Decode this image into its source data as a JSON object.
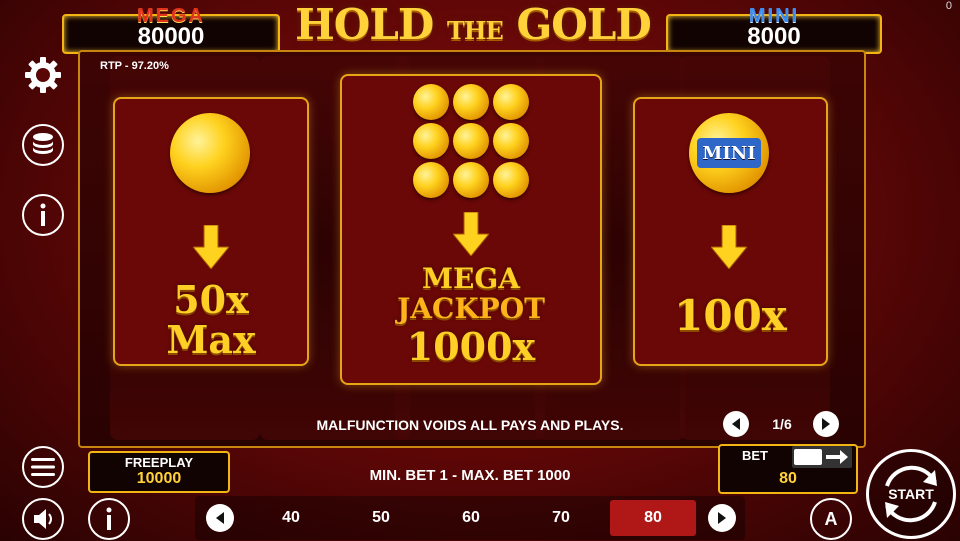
{
  "jackpots": {
    "mega": {
      "title": "MEGA",
      "value": "80000"
    },
    "mini": {
      "title": "MINI",
      "value": "8000"
    }
  },
  "logo": {
    "word1": "HOLD",
    "word2": "THE",
    "word3": "GOLD"
  },
  "corner_counter": "0",
  "rtp": "RTP - 97.20%",
  "panels": {
    "left": {
      "line1": "50x",
      "line2": "Max"
    },
    "center": {
      "line1": "MEGA",
      "line2": "JACKPOT",
      "line3": "1000x"
    },
    "right": {
      "coin_label": "MINI",
      "line1": "100x"
    }
  },
  "notice": "MALFUNCTION VOIDS ALL PAYS AND PLAYS.",
  "pager": {
    "label": "1/6"
  },
  "freeplay": {
    "label": "FREEPLAY",
    "value": "10000"
  },
  "bet_range": "MIN. BET 1 - MAX. BET 1000",
  "bet": {
    "label": "BET",
    "value": "80"
  },
  "bet_options": [
    "40",
    "50",
    "60",
    "70",
    "80"
  ],
  "bet_selected": "80",
  "start_label": "START",
  "autoplay_label": "A",
  "colors": {
    "gold": "#ffcf25",
    "frame": "#f2b514",
    "active_bet": "#b01818",
    "mega_title": "#e0331a",
    "mini_title": "#3d8df0"
  }
}
